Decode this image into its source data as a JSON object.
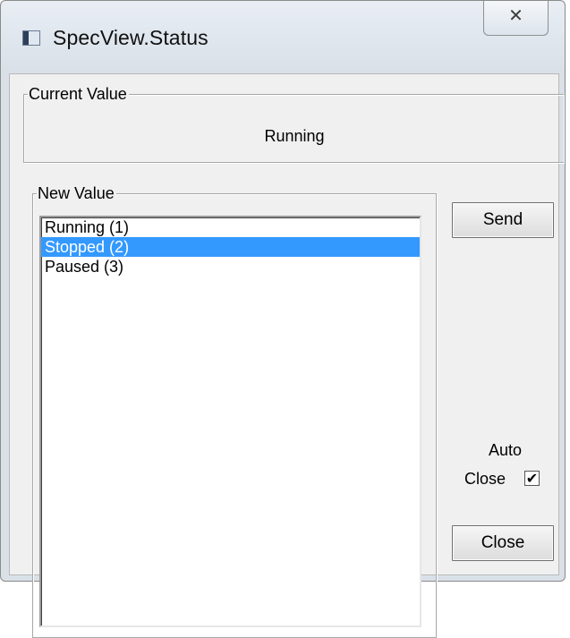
{
  "window": {
    "title": "SpecView.Status",
    "icon": "app-window-icon",
    "close_glyph": "✕"
  },
  "current_value": {
    "legend": "Current Value",
    "value": "Running"
  },
  "new_value": {
    "legend": "New Value",
    "items": [
      {
        "label": "Running (1)",
        "selected": false
      },
      {
        "label": "Stopped (2)",
        "selected": true
      },
      {
        "label": "Paused (3)",
        "selected": false
      }
    ]
  },
  "buttons": {
    "send": "Send",
    "close": "Close"
  },
  "auto_close": {
    "line1": "Auto",
    "line2": "Close",
    "checked": true,
    "check_glyph": "✔"
  },
  "colors": {
    "selection": "#3399ff"
  }
}
